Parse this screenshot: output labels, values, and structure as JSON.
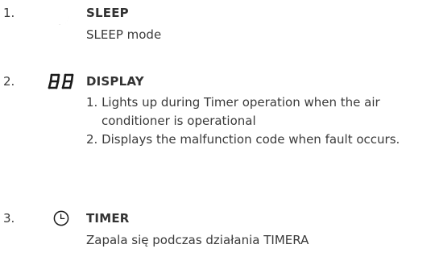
{
  "items": [
    {
      "number": "1.",
      "icon": "moon-icon",
      "title": "SLEEP",
      "description": "SLEEP mode"
    },
    {
      "number": "2.",
      "icon": "seven-segment-88-icon",
      "title": "DISPLAY",
      "lines": [
        "1. Lights up during Timer operation when the air conditioner is operational",
        "2. Displays the malfunction code when fault occurs."
      ]
    },
    {
      "number": "3.",
      "icon": "clock-icon",
      "title": "TIMER",
      "description": "Zapala się podczas działania TIMERA"
    }
  ]
}
